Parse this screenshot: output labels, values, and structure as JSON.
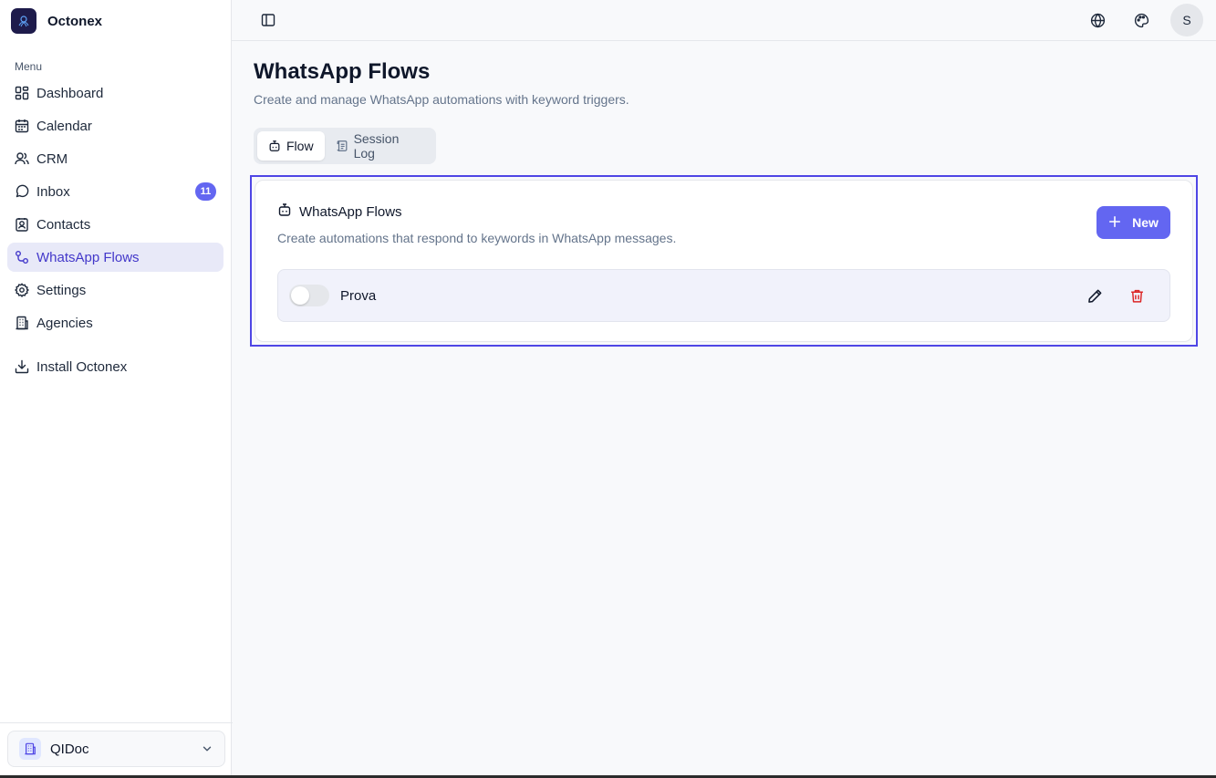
{
  "brand": {
    "name": "Octonex",
    "logo_text": "OCTONEX"
  },
  "sidebar": {
    "menu_label": "Menu",
    "items": [
      {
        "label": "Dashboard",
        "icon": "dashboard-icon"
      },
      {
        "label": "Calendar",
        "icon": "calendar-icon"
      },
      {
        "label": "CRM",
        "icon": "users-icon"
      },
      {
        "label": "Inbox",
        "icon": "message-circle-icon",
        "badge": "11"
      },
      {
        "label": "Contacts",
        "icon": "contact-icon"
      },
      {
        "label": "WhatsApp Flows",
        "icon": "workflow-icon",
        "active": true
      },
      {
        "label": "Settings",
        "icon": "gear-icon"
      },
      {
        "label": "Agencies",
        "icon": "building-icon"
      }
    ],
    "install_label": "Install Octonex",
    "org": {
      "name": "QIDoc"
    }
  },
  "topbar": {
    "avatar_initial": "S"
  },
  "page": {
    "title": "WhatsApp Flows",
    "subtitle": "Create and manage WhatsApp automations with keyword triggers."
  },
  "tabs": [
    {
      "label": "Flow",
      "active": true
    },
    {
      "label": "Session Log",
      "active": false
    }
  ],
  "card": {
    "title": "WhatsApp Flows",
    "subtitle": "Create automations that respond to keywords in WhatsApp messages.",
    "new_label": "New"
  },
  "flows": [
    {
      "name": "Prova",
      "enabled": false
    }
  ],
  "colors": {
    "accent": "#6366f1",
    "active_nav_bg": "#e8e9f8",
    "delete": "#dc2626",
    "highlight_border": "#4f46e5"
  }
}
